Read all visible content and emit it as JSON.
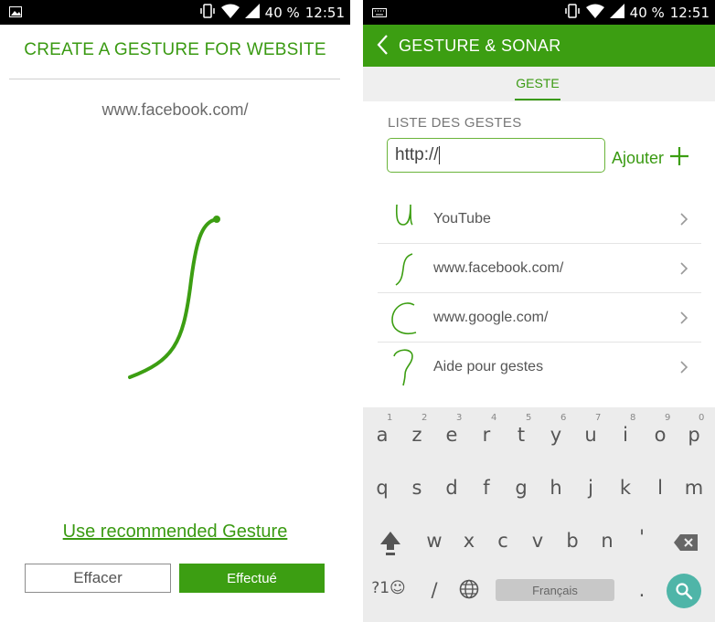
{
  "left": {
    "status": {
      "battery": "40 %",
      "time": "12:51"
    },
    "title": "CREATE A GESTURE FOR WEBSITE",
    "url": "www.facebook.com/",
    "recommended_link": "Use recommended Gesture",
    "clear_button": "Effacer",
    "done_button": "Effectué"
  },
  "right": {
    "status": {
      "battery": "40 %",
      "time": "12:51"
    },
    "appbar_title": "GESTURE & SONAR",
    "tab": "GESTE",
    "section_label": "LISTE DES GESTES",
    "input_value": "http://",
    "add_button": "Ajouter",
    "gestures": [
      {
        "label": "YouTube",
        "icon": "gesture-u-icon"
      },
      {
        "label": "www.facebook.com/",
        "icon": "gesture-s-icon"
      },
      {
        "label": "www.google.com/",
        "icon": "gesture-c-icon"
      },
      {
        "label": "Aide pour gestes",
        "icon": "gesture-question-icon"
      }
    ],
    "keyboard": {
      "row1": [
        "a",
        "z",
        "e",
        "r",
        "t",
        "y",
        "u",
        "i",
        "o",
        "p"
      ],
      "row1_hints": [
        "1",
        "2",
        "3",
        "4",
        "5",
        "6",
        "7",
        "8",
        "9",
        "0"
      ],
      "row2": [
        "q",
        "s",
        "d",
        "f",
        "g",
        "h",
        "j",
        "k",
        "l",
        "m"
      ],
      "row3": [
        "w",
        "x",
        "c",
        "v",
        "b",
        "n",
        "'"
      ],
      "symbols_key": "?1☺",
      "slash_key": "/",
      "space_label": "Français",
      "period_key": "."
    }
  },
  "colors": {
    "accent": "#3c9e12",
    "fab": "#4fb5a8"
  }
}
